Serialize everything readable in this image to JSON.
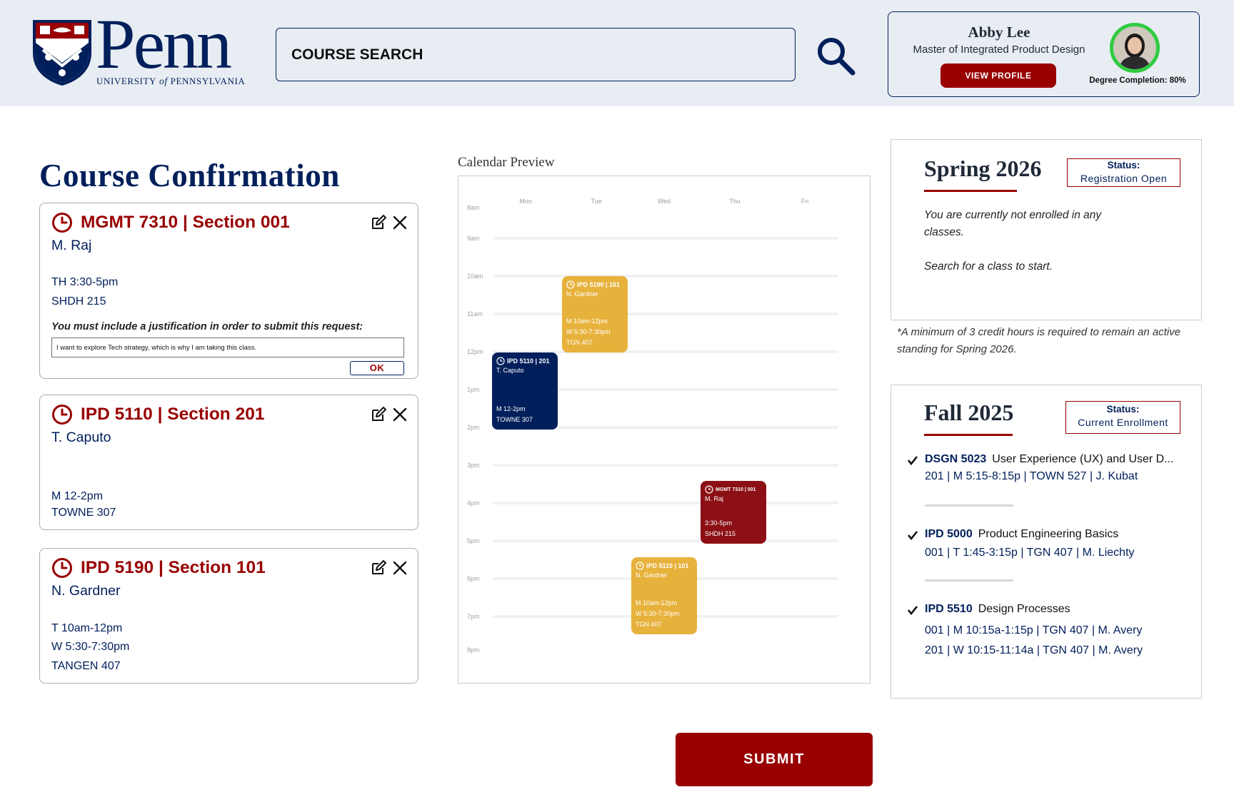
{
  "header": {
    "logo_word": "Penn",
    "logo_sub_1": "University",
    "logo_sub_of": "of",
    "logo_sub_2": "Pennsylvania",
    "search_placeholder": "COURSE SEARCH",
    "icons": {
      "search": "search-icon",
      "shield": "penn-shield-logo"
    }
  },
  "profile": {
    "name": "Abby Lee",
    "program": "Master of Integrated Product Design",
    "view_profile_label": "VIEW PROFILE",
    "degree_completion": "Degree Completion: 80%",
    "completion_fraction": 0.8
  },
  "page": {
    "title": "Course Confirmation",
    "calendar_title": "Calendar Preview",
    "submit_label": "SUBMIT"
  },
  "courses": [
    {
      "title": "MGMT 7310 | Section 001",
      "instructor": "M. Raj",
      "lines": [
        "TH 3:30-5pm",
        "SHDH 215"
      ],
      "justification_label": "You must include a justification in order to submit this request:",
      "justification_value": "I want to explore Tech strategy, which is why I am taking this class.",
      "ok_label": "OK"
    },
    {
      "title": "IPD 5110 | Section 201",
      "instructor": "T. Caputo",
      "lines": [
        "M 12-2pm",
        "TOWNE 307"
      ]
    },
    {
      "title": "IPD 5190 | Section 101",
      "instructor": "N. Gardner",
      "lines": [
        "T 10am-12pm",
        "W 5:30-7:30pm",
        "TANGEN 407"
      ]
    }
  ],
  "calendar": {
    "days": [
      "Mon",
      "Tue",
      "Wed",
      "Thu",
      "Fri"
    ],
    "hours": [
      "8am",
      "9am",
      "10am",
      "11am",
      "12pm",
      "1pm",
      "2pm",
      "3pm",
      "4pm",
      "5pm",
      "6pm",
      "7pm",
      "8pm"
    ],
    "events": [
      {
        "title": "IPD 5190 | 101",
        "instructor": "N. Gardner",
        "lines": [
          "M 10am-12pm",
          "W 5:30-7:30pm",
          "TGN 407"
        ],
        "color": "#e7b23c"
      },
      {
        "title": "IPD 5110 | 201",
        "instructor": "T. Caputo",
        "lines": [
          "M 12-2pm",
          "TOWNE 307"
        ],
        "color": "#011f5b"
      },
      {
        "title": "MGMT 7310 | 001",
        "instructor": "M. Raj",
        "lines": [
          "3:30-5pm",
          "SHDH 215"
        ],
        "color": "#8b0f14"
      },
      {
        "title": "IPD 5110 | 101",
        "instructor": "N. Gardner",
        "lines": [
          "M 10am-12pm",
          "W 5:30-7:30pm",
          "TGN 407"
        ],
        "color": "#e7b23c"
      }
    ]
  },
  "spring": {
    "title": "Spring 2026",
    "status_label": "Status:",
    "status_value": "Registration Open",
    "message_1": "You are currently not enrolled in any classes.",
    "message_2": "Search for a class to start.",
    "note": "*A minimum of 3 credit hours is required to remain an active standing for Spring 2026."
  },
  "fall": {
    "title": "Fall 2025",
    "status_label": "Status:",
    "status_value": "Current Enrollment",
    "enrollments": [
      {
        "code": "DSGN 5023",
        "name": "User Experience (UX) and User D...",
        "sections": [
          "201  |  M 5:15-8:15p  |  TOWN 527  |     J. Kubat"
        ]
      },
      {
        "code": "IPD 5000",
        "name": "Product Engineering Basics",
        "sections": [
          "001  |  T 1:45-3:15p   |    TGN 407    |    M. Liechty"
        ]
      },
      {
        "code": "IPD 5510",
        "name": "Design Processes",
        "sections": [
          "001  |  M 10:15a-1:15p  |    TGN 407    |     M. Avery",
          "201  |  W 10:15-11:14a  |    TGN 407    |     M. Avery"
        ]
      }
    ]
  },
  "colors": {
    "navy": "#011f5b",
    "penn_red": "#990000",
    "gold": "#e7b23c",
    "progress_green": "#2ecc40"
  }
}
